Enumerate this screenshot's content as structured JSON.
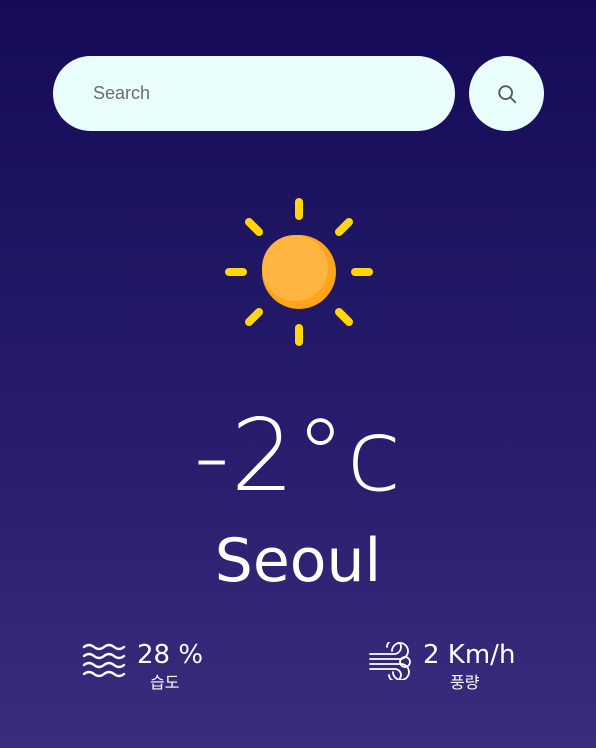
{
  "search": {
    "placeholder": "Search",
    "button_icon": "search-icon"
  },
  "weather": {
    "icon": "sun-icon",
    "temperature": "-2°c",
    "city": "Seoul"
  },
  "stats": {
    "humidity": {
      "icon": "humidity-waves-icon",
      "value": "28 %",
      "label": "습도"
    },
    "wind": {
      "icon": "wind-icon",
      "value": "2 Km/h",
      "label": "풍량"
    }
  },
  "colors": {
    "background_top": "#150b57",
    "background_bottom": "#3a2d7e",
    "search_bg": "#eafffd",
    "sun_rays": "#ffd60a",
    "sun_core": "#ffb13b"
  }
}
